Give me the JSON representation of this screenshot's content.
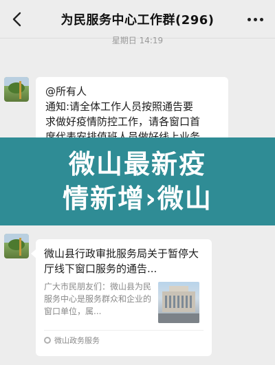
{
  "header": {
    "back_icon": "chevron-left-icon",
    "title": "为民服务中心工作群(296)",
    "more_icon": "ellipsis-icon"
  },
  "timestamp": "星期日 14:19",
  "messages": [
    {
      "type": "text",
      "lines": [
        "@所有人",
        "通知:请全体工作人员按照通告要",
        "求做好疫情防控工作，请各窗口首",
        "席代表安排值班人员做好线上业务"
      ]
    }
  ],
  "banner": {
    "line1": "微山最新疫",
    "line2": "情新增›微山"
  },
  "share_card": {
    "title": "微山县行政审批服务局关于暂停大厅线下窗口服务的通告...",
    "description": "广大市民朋友们：微山县为民服务中心是服务群众和企业的窗口单位，属...",
    "source": "微山政务服务",
    "source_icon": "mini-program-icon",
    "thumbnail": "building-thumbnail"
  },
  "colors": {
    "background": "#ededed",
    "bubble": "#ffffff",
    "banner": "#2f8c95",
    "timestamp": "#9a9a9a"
  }
}
